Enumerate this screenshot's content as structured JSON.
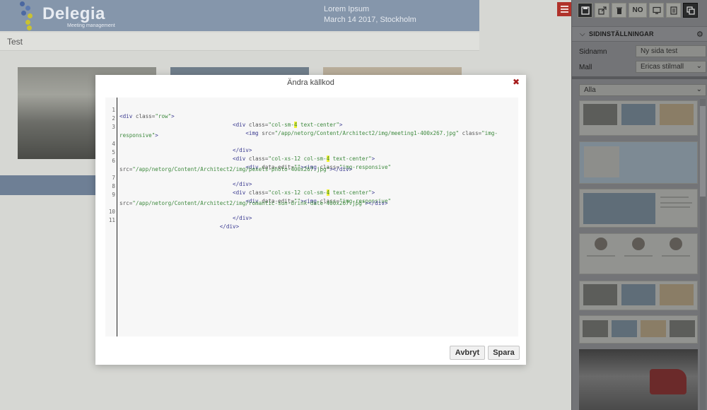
{
  "site": {
    "logo_text": "Delegia",
    "logo_sub": "Meeting management",
    "event_title": "Lorem Ipsum",
    "event_subtitle": "March 14 2017, Stockholm",
    "breadcrumb": "Test"
  },
  "toolbar": {
    "language_button": "NO"
  },
  "sidebar": {
    "section_title": "SIDINSTÄLLNINGAR",
    "page_name_label": "Sidnamn",
    "page_name_value": "Ny sida test",
    "template_label": "Mall",
    "template_value": "Ericas stilmall",
    "filter_value": "Alla"
  },
  "modal": {
    "title": "Ändra källkod",
    "cancel_label": "Avbryt",
    "save_label": "Spara",
    "lines": [
      {
        "n": "1"
      },
      {
        "n": "2"
      },
      {
        "n": "3"
      },
      {
        "n": "4"
      },
      {
        "n": "5"
      },
      {
        "n": "6"
      },
      {
        "n": "7"
      },
      {
        "n": "8"
      },
      {
        "n": "9"
      },
      {
        "n": "10"
      },
      {
        "n": "11"
      }
    ]
  },
  "colors": {
    "header_blue": "#8596ab",
    "menu_red": "#b0322a",
    "close_red": "#a61c1c",
    "highlight_yellow": "#f2f233"
  }
}
